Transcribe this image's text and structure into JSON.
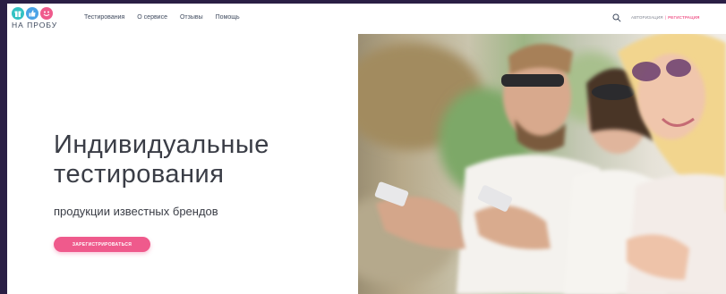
{
  "logo": {
    "text": "НА ПРОБУ"
  },
  "nav": {
    "items": [
      {
        "label": "Тестирования"
      },
      {
        "label": "О сервисе"
      },
      {
        "label": "Отзывы"
      },
      {
        "label": "Помощь"
      }
    ]
  },
  "auth": {
    "login": "АВТОРИЗАЦИЯ",
    "separator": "|",
    "register": "РЕГИСТРАЦИЯ"
  },
  "hero": {
    "title_line1": "Индивидуальные",
    "title_line2": "тестирования",
    "subtitle": "продукции известных брендов",
    "cta": "ЗАРЕГИСТРИРОВАТЬСЯ"
  },
  "colors": {
    "accent": "#ef5a8c",
    "teal": "#33c2c3",
    "blue": "#4aa3e6",
    "text": "#3a3d46",
    "frame": "#2a1f45"
  },
  "icons": [
    "gift-icon",
    "thumbs-up-icon",
    "smile-icon",
    "search-icon"
  ]
}
